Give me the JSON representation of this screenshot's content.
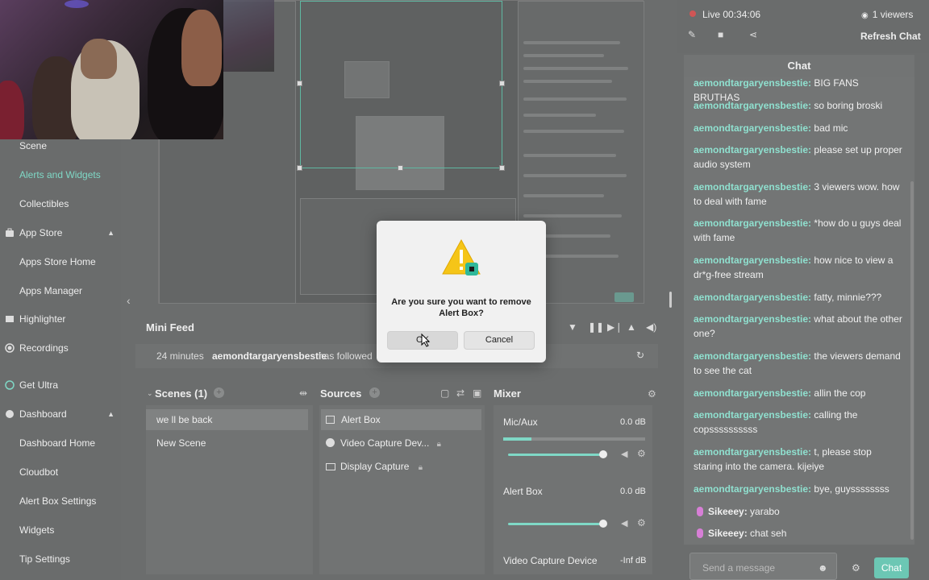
{
  "sidebar": {
    "items": [
      {
        "label": "Scene"
      },
      {
        "label": "Alerts and Widgets"
      },
      {
        "label": "Collectibles"
      },
      {
        "label": "App Store"
      },
      {
        "label": "Apps Store Home"
      },
      {
        "label": "Apps Manager"
      },
      {
        "label": "Highlighter"
      },
      {
        "label": "Recordings"
      },
      {
        "label": "Get Ultra"
      },
      {
        "label": "Dashboard"
      },
      {
        "label": "Dashboard Home"
      },
      {
        "label": "Cloudbot"
      },
      {
        "label": "Alert Box Settings"
      },
      {
        "label": "Widgets"
      },
      {
        "label": "Tip Settings"
      }
    ]
  },
  "mini_feed": {
    "title": "Mini Feed",
    "event": {
      "time": "24 minutes",
      "user": "aemondtargaryensbestie",
      "action": "has followed"
    }
  },
  "scenes": {
    "title": "Scenes (1)",
    "items": [
      "we ll be back",
      "New Scene"
    ]
  },
  "sources": {
    "title": "Sources",
    "items": [
      "Alert Box",
      "Video Capture Dev...",
      "Display Capture"
    ]
  },
  "mixer": {
    "title": "Mixer",
    "channels": [
      {
        "name": "Mic/Aux",
        "level": "0.0 dB"
      },
      {
        "name": "Alert Box",
        "level": "0.0 dB"
      },
      {
        "name": "Video Capture Device",
        "level": "-Inf dB"
      }
    ]
  },
  "stream": {
    "live": "Live 00:34:06",
    "viewers": "1 viewers",
    "refresh": "Refresh Chat"
  },
  "chat": {
    "title": "Chat",
    "messages": [
      {
        "user": "aemondtargaryensbestie:",
        "text": " BIG FANS BRUTHAS"
      },
      {
        "user": "aemondtargaryensbestie:",
        "text": " so boring broski"
      },
      {
        "user": "aemondtargaryensbestie:",
        "text": " bad mic"
      },
      {
        "user": "aemondtargaryensbestie:",
        "text": " please set up proper audio system"
      },
      {
        "user": "aemondtargaryensbestie:",
        "text": " 3 viewers wow. how to deal with fame"
      },
      {
        "user": "aemondtargaryensbestie:",
        "text": " *how do u guys deal with fame"
      },
      {
        "user": "aemondtargaryensbestie:",
        "text": " how nice to view a dr*g-free stream"
      },
      {
        "user": "aemondtargaryensbestie:",
        "text": " fatty, minnie???"
      },
      {
        "user": "aemondtargaryensbestie:",
        "text": " what about the other one?"
      },
      {
        "user": "aemondtargaryensbestie:",
        "text": " the viewers demand to see the cat"
      },
      {
        "user": "aemondtargaryensbestie:",
        "text": " allin the cop"
      },
      {
        "user": "aemondtargaryensbestie:",
        "text": " calling the copssssssssss"
      },
      {
        "user": "aemondtargaryensbestie:",
        "text": " t, please stop staring into the camera. kijeiye"
      },
      {
        "user": "aemondtargaryensbestie:",
        "text": " bye, guyssssssss"
      },
      {
        "user": "Sikeeey:",
        "text": " yarabo"
      },
      {
        "user": "Sikeeey:",
        "text": " chat seh"
      }
    ],
    "input_placeholder": "Send a message",
    "send_label": "Chat"
  },
  "dialog": {
    "message": "Are you sure you want to remove Alert Box?",
    "ok_label": "OK",
    "cancel_label": "Cancel"
  },
  "colors": {
    "accent": "#7fd8c6",
    "live": "#d05555"
  }
}
